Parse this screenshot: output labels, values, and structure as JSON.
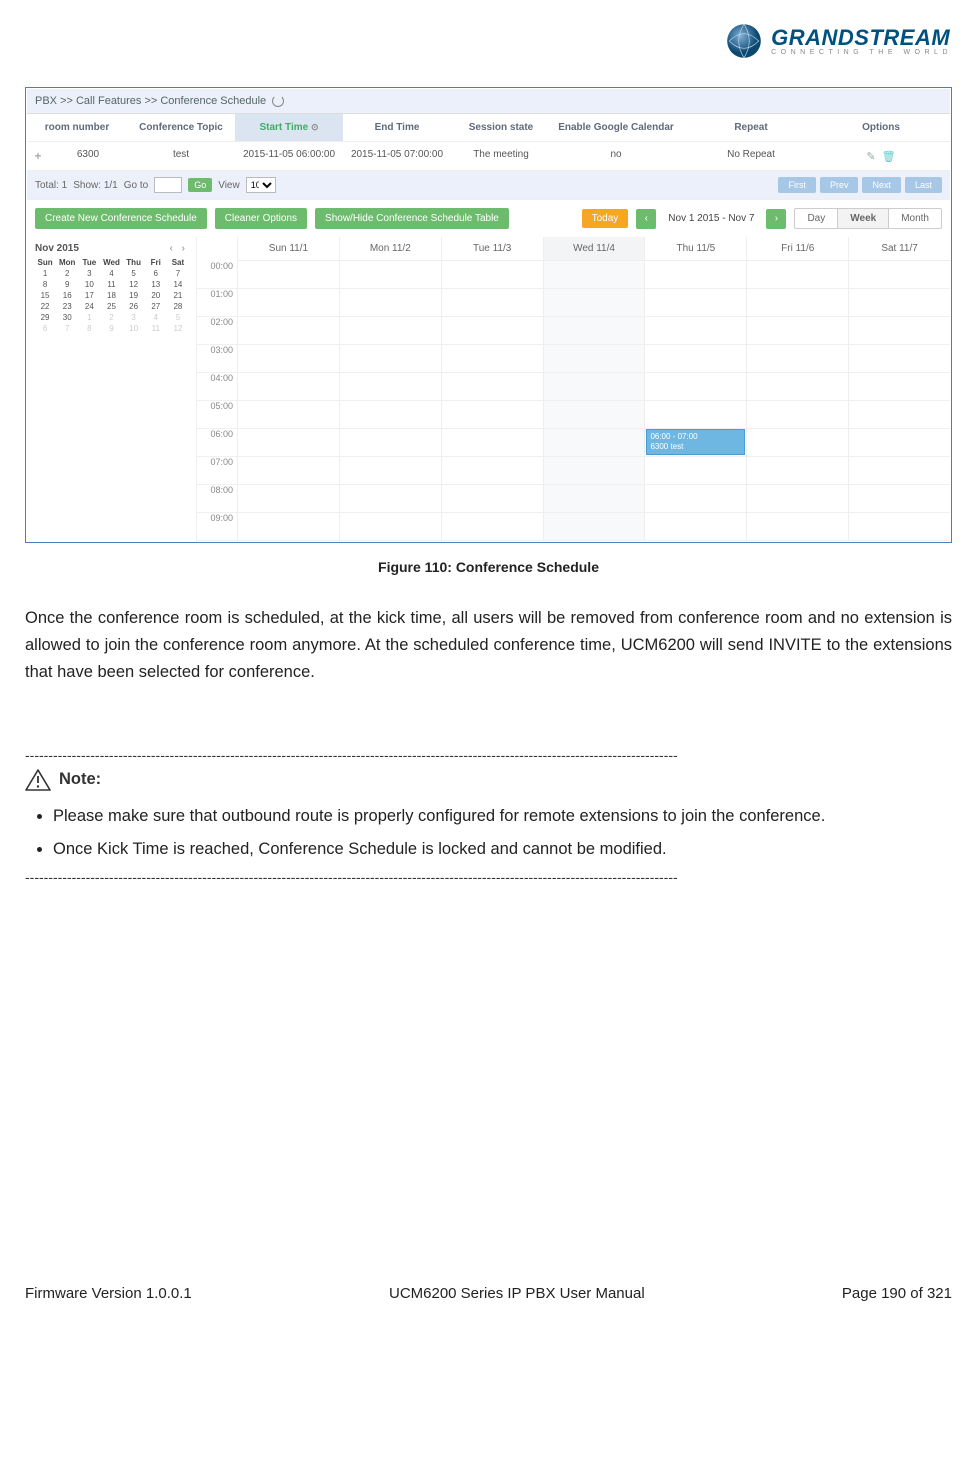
{
  "logo": {
    "main": "GRANDSTREAM",
    "sub": "CONNECTING THE WORLD"
  },
  "ss": {
    "breadcrumb": "PBX >> Call Features >> Conference Schedule",
    "thead": {
      "room": "room number",
      "topic": "Conference Topic",
      "start": "Start Time",
      "end": "End Time",
      "state": "Session state",
      "gcal": "Enable Google Calendar",
      "repeat": "Repeat",
      "opts": "Options"
    },
    "row1": {
      "room": "6300",
      "topic": "test",
      "start": "2015-11-05 06:00:00",
      "end": "2015-11-05 07:00:00",
      "state": "The meeting",
      "gcal": "no",
      "repeat": "No Repeat"
    },
    "pager": {
      "total_label": "Total: 1",
      "show_label": "Show: 1/1",
      "goto_label": "Go to",
      "go_btn": "Go",
      "view_label": "View",
      "view_value": "10",
      "first": "First",
      "prev": "Prev",
      "next": "Next",
      "last": "Last"
    },
    "btns": {
      "new_sched": "Create New Conference Schedule",
      "cleaner": "Cleaner Options",
      "showhide": "Show/Hide Conference Schedule Table",
      "today": "Today",
      "range": "Nov 1 2015 - Nov 7",
      "day": "Day",
      "week": "Week",
      "month": "Month"
    },
    "minical": {
      "title": "Nov 2015",
      "dow": [
        "Sun",
        "Mon",
        "Tue",
        "Wed",
        "Thu",
        "Fri",
        "Sat"
      ],
      "weeks": [
        [
          "1",
          "2",
          "3",
          "4",
          "5",
          "6",
          "7"
        ],
        [
          "8",
          "9",
          "10",
          "11",
          "12",
          "13",
          "14"
        ],
        [
          "15",
          "16",
          "17",
          "18",
          "19",
          "20",
          "21"
        ],
        [
          "22",
          "23",
          "24",
          "25",
          "26",
          "27",
          "28"
        ],
        [
          "29",
          "30",
          "1",
          "2",
          "3",
          "4",
          "5"
        ],
        [
          "6",
          "7",
          "8",
          "9",
          "10",
          "11",
          "12"
        ]
      ]
    },
    "bigcal": {
      "days": [
        "Sun 11/1",
        "Mon 11/2",
        "Tue 11/3",
        "Wed 11/4",
        "Thu 11/5",
        "Fri 11/6",
        "Sat 11/7"
      ],
      "times": [
        "00:00",
        "01:00",
        "02:00",
        "03:00",
        "04:00",
        "05:00",
        "06:00",
        "07:00",
        "08:00",
        "09:00"
      ],
      "event": {
        "time": "06:00 - 07:00",
        "label": "6300 test"
      }
    }
  },
  "figure_caption": "Figure 110: Conference Schedule",
  "body_para": "Once the conference room is scheduled, at the kick time, all users will be removed from conference room and no extension is allowed to join the conference room anymore. At the scheduled conference time, UCM6200 will send INVITE to the extensions that have been selected for conference.",
  "note": {
    "title": "Note:",
    "b1": "Please make sure that outbound route is properly configured for remote extensions to join the conference.",
    "b2": "Once Kick Time is reached, Conference Schedule is locked and cannot be modified."
  },
  "footer": {
    "left": "Firmware Version 1.0.0.1",
    "center": "UCM6200 Series IP PBX User Manual",
    "right": "Page 190 of 321"
  }
}
